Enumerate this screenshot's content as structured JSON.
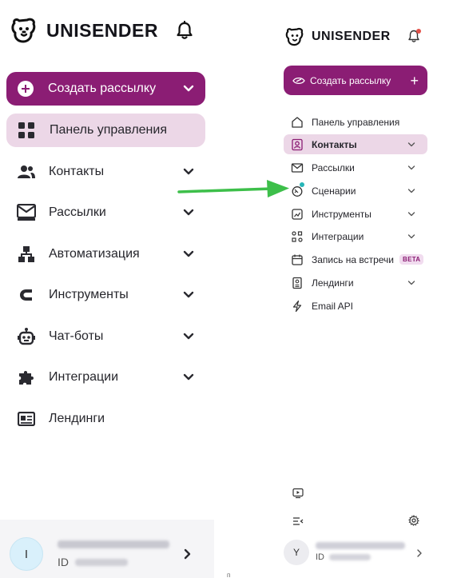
{
  "colors": {
    "brand": "#8b1d74",
    "active_bg": "#ecd7e7",
    "annotation_arrow": "#3dbf4a",
    "notification_dot": "#e3524a",
    "new_feature_dot": "#26b5b7"
  },
  "left_panel": {
    "logo_text": "UNISENDER",
    "create_button_label": "Создать рассылку",
    "dashboard_label": "Панель управления",
    "nav": [
      {
        "label": "Контакты",
        "icon": "users-icon"
      },
      {
        "label": "Рассылки",
        "icon": "mail-icon"
      },
      {
        "label": "Автоматизация",
        "icon": "hierarchy-icon"
      },
      {
        "label": "Инструменты",
        "icon": "magnet-icon"
      },
      {
        "label": "Чат-боты",
        "icon": "robot-icon"
      },
      {
        "label": "Интеграции",
        "icon": "puzzle-icon"
      },
      {
        "label": "Лендинги",
        "icon": "landing-icon"
      }
    ],
    "user": {
      "avatar_letter": "I",
      "id_label": "ID"
    }
  },
  "right_panel": {
    "logo_text": "UNISENDER",
    "create_button_label": "Создать рассылку",
    "nav": [
      {
        "label": "Панель управления",
        "icon": "home-icon"
      },
      {
        "label": "Контакты",
        "icon": "contact-card-icon"
      },
      {
        "label": "Рассылки",
        "icon": "envelope-icon"
      },
      {
        "label": "Сценарии",
        "icon": "scenario-icon"
      },
      {
        "label": "Инструменты",
        "icon": "tools-icon"
      },
      {
        "label": "Интеграции",
        "icon": "integrations-icon"
      },
      {
        "label": "Запись на встречи",
        "icon": "calendar-icon",
        "badge": "BETA"
      },
      {
        "label": "Лендинги",
        "icon": "landing-icon"
      },
      {
        "label": "Email API",
        "icon": "lightning-icon"
      }
    ],
    "user": {
      "avatar_letter": "Y",
      "id_label": "ID"
    }
  },
  "stray_mark": "п"
}
